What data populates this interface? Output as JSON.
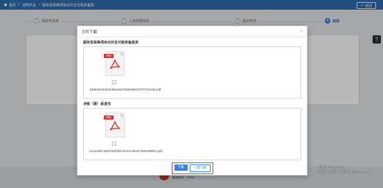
{
  "topbar": {
    "breadcrumb": [
      "首页",
      "证明开具",
      "服务贸易等项目对外支付税务备案"
    ],
    "back_label": "返回"
  },
  "steps": [
    {
      "num": "1",
      "label": "填写申请表"
    },
    {
      "num": "2",
      "label": "上传附报资料"
    },
    {
      "num": "3",
      "label": "提交申请"
    },
    {
      "num": "4",
      "label": "完成"
    }
  ],
  "footer": {
    "line1": "主办单位：国家税务总局甘肃省税务局",
    "line2": "服务热线：12366"
  },
  "watermark": {
    "line1": "激活 Windows",
    "line2": "转到“设置”以激活 Windows。"
  },
  "help_label": "?",
  "modal": {
    "title": "文件下载",
    "close": "×",
    "sections": [
      {
        "title": "服务贸易等项目对外支付税务备案表",
        "file_tag": "PDF",
        "file_name": "33de28c6dcb349ea8d7868e8810707782188.pdf"
      },
      {
        "title": "涉税（费）承诺书",
        "file_tag": "PDF",
        "file_name": "2112a0bc38244af1b0c4c01c06197fe0328861.pdf"
      }
    ],
    "download_label": "下载",
    "download_all_label": "一键下载"
  },
  "colors": {
    "primary": "#2f6db0",
    "button": "#3b82d6",
    "pdf": "#d8342c",
    "highlight": "#e43d3d"
  }
}
